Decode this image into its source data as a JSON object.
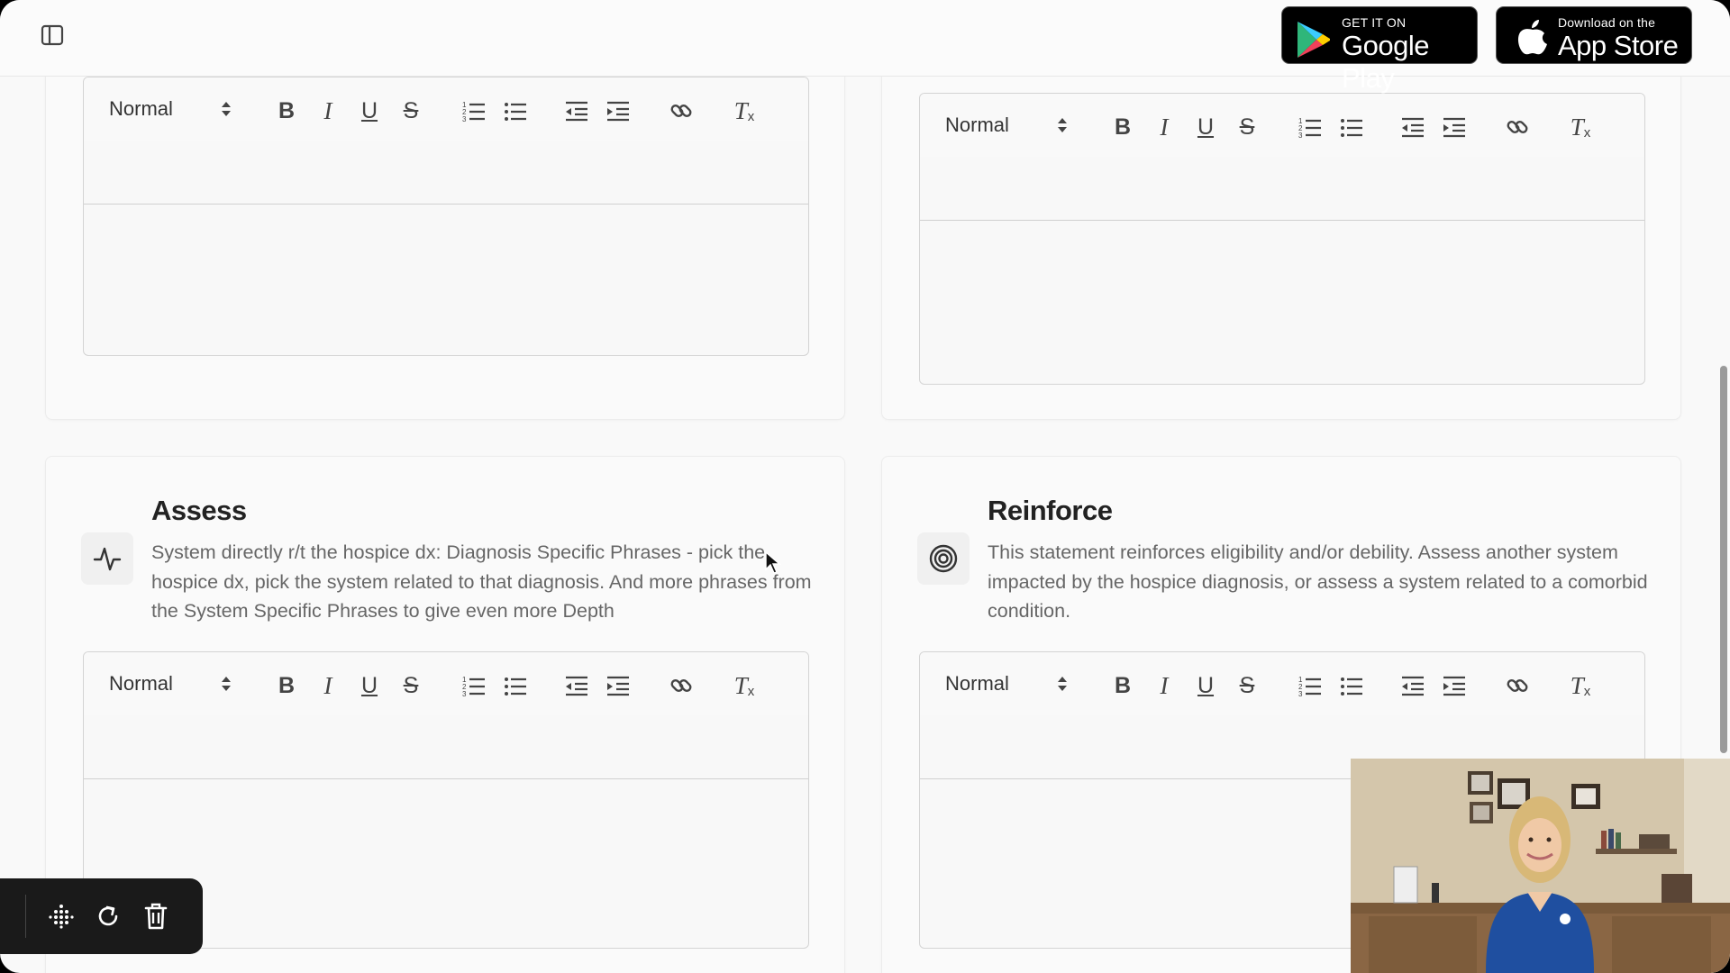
{
  "header": {
    "google_play": {
      "small": "GET IT ON",
      "big": "Google Play"
    },
    "app_store": {
      "small": "Download on the",
      "big": "App Store"
    }
  },
  "editor": {
    "heading_option": "Normal",
    "buttons": {
      "bold": "B",
      "italic": "I",
      "underline": "U",
      "strike": "S",
      "clear": "T"
    }
  },
  "sections": {
    "assess": {
      "title": "Assess",
      "icon": "activity-pulse-icon",
      "description": "System directly r/t the hospice dx: Diagnosis Specific Phrases - pick the hospice dx, pick the system related to that diagnosis. And more phrases from the System Specific Phrases to give even more Depth"
    },
    "reinforce": {
      "title": "Reinforce",
      "icon": "target-icon",
      "description": "This statement reinforces eligibility and/or debility. Assess another system impacted by the hospice diagnosis, or assess a system related to a comorbid condition."
    }
  },
  "float_toolbar": {
    "icons": [
      "drag-grid-icon",
      "refresh-icon",
      "trash-icon"
    ]
  },
  "colors": {
    "background": "#f9f9f9",
    "card": "#fafafa",
    "text_primary": "#222222",
    "text_secondary": "#666666",
    "toolbar_dark": "#1a1a1a"
  }
}
